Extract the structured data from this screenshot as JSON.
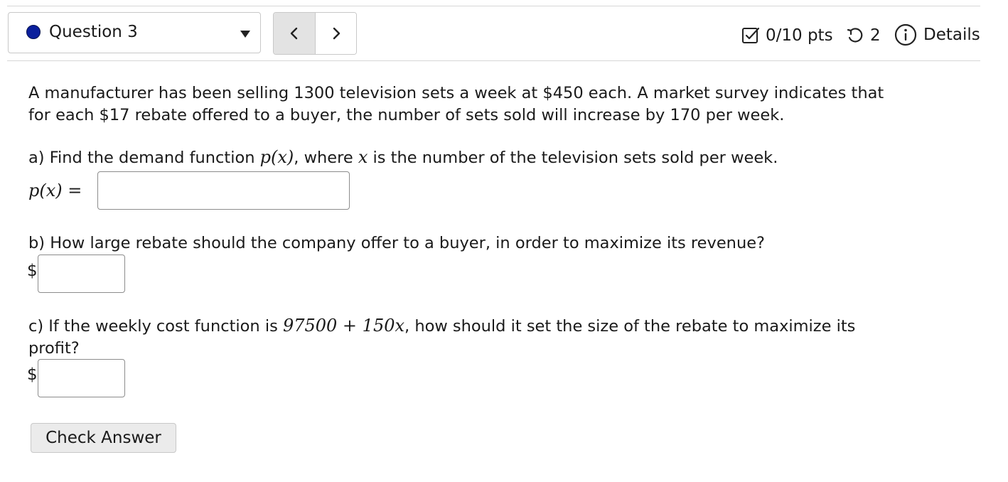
{
  "header": {
    "question_selector": {
      "label": "Question 3",
      "status_color": "#0a1f9c"
    },
    "nav": {
      "prev_icon": "chevron-left-icon",
      "next_icon": "chevron-right-icon"
    },
    "score": {
      "text": "0/10 pts",
      "icon": "checkbox-icon"
    },
    "attempts": {
      "text": "2",
      "icon": "retry-icon"
    },
    "details": {
      "text": "Details",
      "icon": "info-icon"
    }
  },
  "problem": {
    "line1": "A manufacturer has been selling 1300 television sets a week at $450 each. A market survey indicates that",
    "line2": "for each $17 rebate offered to a buyer, the number of sets sold will increase by 170 per week."
  },
  "part_a": {
    "prefix": "a) Find the demand function",
    "func": "p(x)",
    "middle": ", where",
    "var": "x",
    "suffix": "is the number of the television sets sold per week.",
    "answer_label": "p(x) =",
    "answer_value": ""
  },
  "part_b": {
    "text": "b) How large rebate should the company offer to a buyer, in order to maximize its revenue?",
    "currency": "$",
    "answer_value": ""
  },
  "part_c": {
    "prefix": "c) If the weekly cost function is",
    "formula": "97500 + 150x",
    "suffix": ", how should it set the size of the rebate to maximize its",
    "line2": "profit?",
    "currency": "$",
    "answer_value": ""
  },
  "actions": {
    "check_answer": "Check Answer"
  }
}
